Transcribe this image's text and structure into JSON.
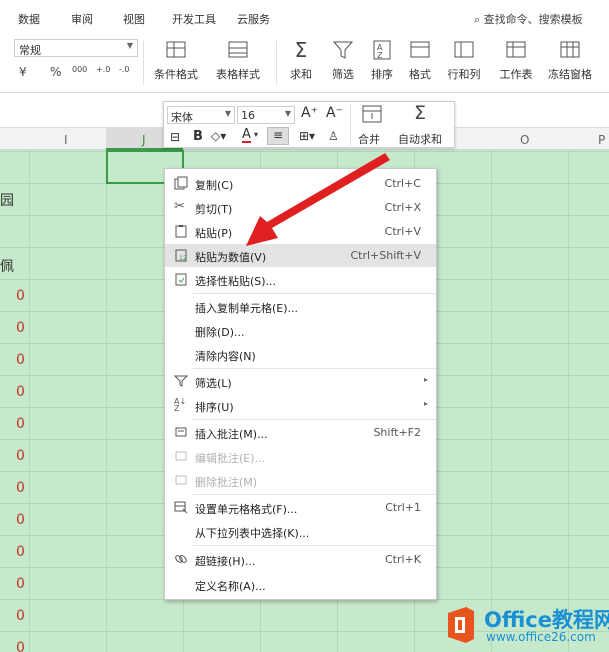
{
  "tabs": [
    "数据",
    "审阅",
    "视图",
    "开发工具",
    "云服务"
  ],
  "search": "查找命令、搜索模板",
  "ribbon": {
    "number_format": "常规",
    "fmt_buttons": [
      "¥",
      "%",
      "000",
      "+.0",
      "-.0"
    ],
    "buttons": [
      "条件格式",
      "表格样式",
      "求和",
      "筛选",
      "排序",
      "格式",
      "行和列",
      "工作表",
      "冻结窗格"
    ]
  },
  "columns": [
    "I",
    "J",
    "O",
    "P"
  ],
  "left_chars": [
    "园",
    "佩"
  ],
  "cell_values": [
    "0",
    "0",
    "0",
    "0",
    "0",
    "0",
    "0",
    "0",
    "0",
    "0",
    "0",
    "0"
  ],
  "mini_toolbar": {
    "font": "宋体",
    "size": "16",
    "bold": "B",
    "font_color": "A",
    "merge": "合并",
    "autosum": "自动求和"
  },
  "menu": {
    "items": [
      {
        "label": "复制(C)",
        "shortcut": "Ctrl+C",
        "icon": "copy-icon"
      },
      {
        "label": "剪切(T)",
        "shortcut": "Ctrl+X",
        "icon": "scissors-icon"
      },
      {
        "label": "粘贴(P)",
        "shortcut": "Ctrl+V",
        "icon": "paste-icon"
      },
      {
        "label": "粘贴为数值(V)",
        "shortcut": "Ctrl+Shift+V",
        "icon": "paste-values-icon"
      },
      {
        "label": "选择性粘贴(S)...",
        "shortcut": "",
        "icon": "paste-special-icon"
      },
      {
        "label": "插入复制单元格(E)...",
        "shortcut": "",
        "icon": ""
      },
      {
        "label": "删除(D)...",
        "shortcut": "",
        "icon": ""
      },
      {
        "label": "清除内容(N)",
        "shortcut": "",
        "icon": ""
      },
      {
        "label": "筛选(L)",
        "shortcut": "",
        "icon": "filter-icon"
      },
      {
        "label": "排序(U)",
        "shortcut": "",
        "icon": "sort-icon"
      },
      {
        "label": "插入批注(M)...",
        "shortcut": "Shift+F2",
        "icon": "comment-icon"
      },
      {
        "label": "编辑批注(E)...",
        "shortcut": "",
        "icon": "edit-comment-icon"
      },
      {
        "label": "删除批注(M)",
        "shortcut": "",
        "icon": "delete-comment-icon"
      },
      {
        "label": "设置单元格格式(F)...",
        "shortcut": "Ctrl+1",
        "icon": "format-cells-icon"
      },
      {
        "label": "从下拉列表中选择(K)...",
        "shortcut": "",
        "icon": ""
      },
      {
        "label": "超链接(H)...",
        "shortcut": "Ctrl+K",
        "icon": "link-icon"
      },
      {
        "label": "定义名称(A)...",
        "shortcut": "",
        "icon": ""
      }
    ]
  },
  "watermark": {
    "title": "Office教程网",
    "url": "www.office26.com"
  },
  "colors": {
    "grid_bg": "#c6e9cc",
    "accent_green": "#3b9a4a",
    "arrow_red": "#e02020",
    "cell_red": "#c0392b",
    "watermark_blue": "#1a8fd4",
    "logo_orange": "#e8541e"
  }
}
